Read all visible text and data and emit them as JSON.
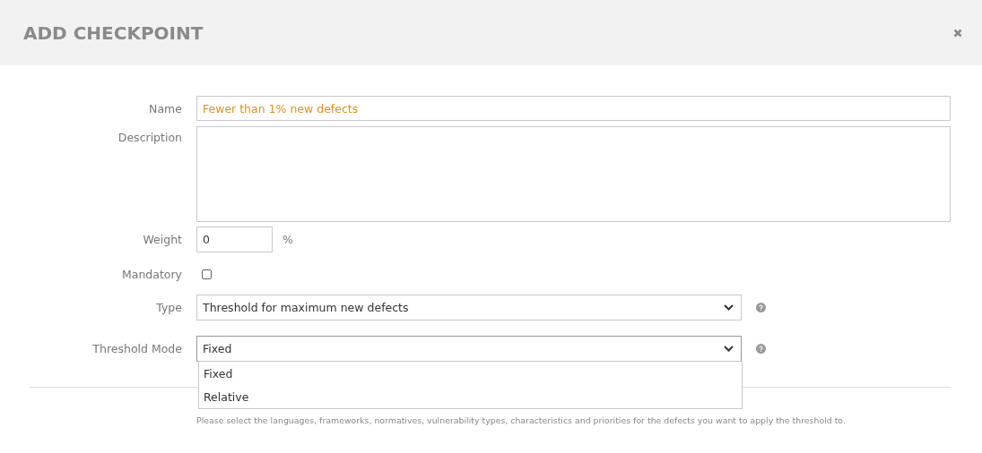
{
  "window": {
    "title": "ADD CHECKPOINT"
  },
  "form": {
    "name": {
      "label": "Name",
      "value": "Fewer than 1% new defects"
    },
    "description": {
      "label": "Description"
    },
    "weight": {
      "label": "Weight",
      "value": "0",
      "unit": "%"
    },
    "mandatory": {
      "label": "Mandatory",
      "checked": false
    },
    "type": {
      "label": "Type",
      "value": "Threshold for maximum new defects",
      "expanded": false
    },
    "threshold_mode": {
      "label": "Threshold Mode",
      "value": "Fixed",
      "expanded": true,
      "options": [
        "Fixed",
        "Relative"
      ]
    }
  },
  "hint": "Please select the languages, frameworks, normatives, vulnerability types, characteristics and priorities for the defects you want to apply the threshold to."
}
